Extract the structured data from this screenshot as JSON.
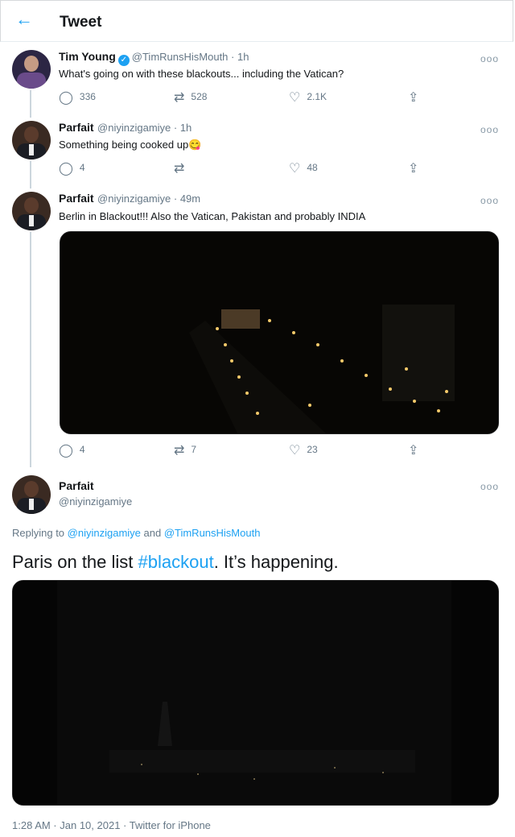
{
  "header": {
    "back_icon": "←",
    "title": "Tweet"
  },
  "tweets": [
    {
      "name": "Tim Young",
      "handle": "@TimRunsHisMouth · 1h",
      "text": "What's going on with these blackouts... including the Vatican?",
      "replies": "336",
      "retweets": "528",
      "likes": "2.1K"
    },
    {
      "name": "Parfait",
      "handle": "@niyinzigamiye · 1h",
      "text": "Something being cooked up😋",
      "replies": "4",
      "retweets": "",
      "likes": "48"
    },
    {
      "name": "Parfait",
      "handle": "@niyinzigamiye · 49m",
      "text": "Berlin in Blackout!!! Also the Vatican, Pakistan and probably INDIA",
      "replies": "4",
      "retweets": "7",
      "likes": "23"
    }
  ],
  "main": {
    "name": "Parfait",
    "handle": "@niyinzigamiye",
    "replying_prefix": "Replying to ",
    "reply_to_1": "@niyinzigamiye",
    "reply_and": " and ",
    "reply_to_2": "@TimRunsHisMouth",
    "text_before": "Paris on the list ",
    "hashtag": "#blackout",
    "text_after": ". It’s happening.",
    "timestamp": "1:28 AM · Jan 10, 2021 · Twitter for iPhone"
  },
  "icons": {
    "more": "ooo",
    "reply": "reply-icon",
    "retweet": "retweet-icon",
    "like": "heart-icon",
    "share": "share-icon"
  },
  "colors": {
    "accent": "#1da1f2",
    "muted": "#657786"
  }
}
